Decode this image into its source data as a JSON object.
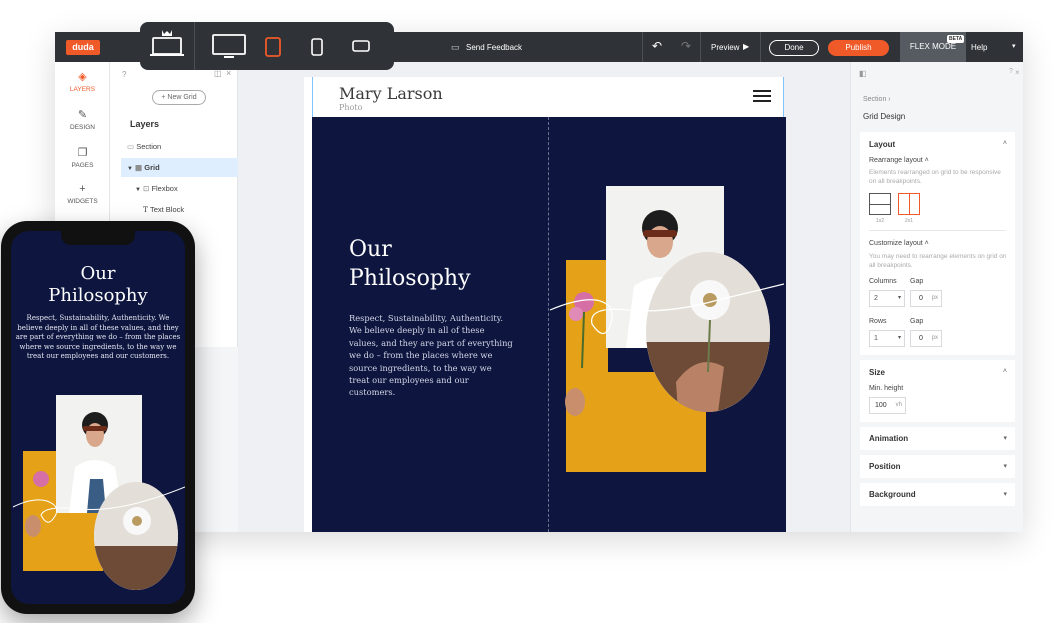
{
  "topbar": {
    "logo": "duda",
    "feedback": "Send Feedback",
    "preview": "Preview",
    "done": "Done",
    "publish": "Publish",
    "flex_mode": "FLEX MODE",
    "beta": "BETA",
    "help": "Help"
  },
  "icon_sidebar": {
    "items": [
      {
        "label": "LAYERS",
        "icon": "layers-icon"
      },
      {
        "label": "DESIGN",
        "icon": "brush-icon"
      },
      {
        "label": "PAGES",
        "icon": "pages-icon"
      },
      {
        "label": "WIDGETS",
        "icon": "plus-icon"
      }
    ]
  },
  "layers_panel": {
    "new_grid": "+ New Grid",
    "title": "Layers",
    "rows": [
      "Section",
      "Grid",
      "Flexbox",
      "Text Block"
    ]
  },
  "site": {
    "name": "Mary Larson",
    "subtitle": "Photo",
    "hero_title_line1": "Our",
    "hero_title_line2": "Philosophy",
    "hero_body": "Respect, Sustainability, Authenticity. We believe deeply in all of these values, and they are part of everything we do – from the places where we source ingredients, to the way we treat our employees and our customers.",
    "mobile_body": "Respect, Sustainability, Authenticity. We believe deeply in all of these values, and they are part of everything we do – from the places where we source ingredients, to the way we treat our employees and our customers."
  },
  "right_panel": {
    "crumb": "Section ›",
    "title": "Grid Design",
    "layout": {
      "heading": "Layout",
      "rearrange_label": "Rearrange layout ˄",
      "rearrange_hint": "Elements rearranged on grid to be responsive on all breakpoints.",
      "opt1": "1x2",
      "opt2": "2x1",
      "customize_label": "Customize layout ˄",
      "customize_hint": "You may need to rearrange elements on grid on all breakpoints.",
      "columns_label": "Columns",
      "columns_value": "2",
      "gap_label": "Gap",
      "gap1_value": "0",
      "rows_label": "Rows",
      "rows_value": "1",
      "gap2_value": "0",
      "unit_px": "px"
    },
    "size": {
      "heading": "Size",
      "min_height_label": "Min. height",
      "min_height_value": "100",
      "unit_vh": "vh"
    },
    "collapsed": [
      "Animation",
      "Position",
      "Background"
    ]
  },
  "colors": {
    "accent": "#f05a28",
    "topbar": "#2f3337",
    "hero_bg": "#0e1640",
    "selection": "#dfeefe"
  }
}
